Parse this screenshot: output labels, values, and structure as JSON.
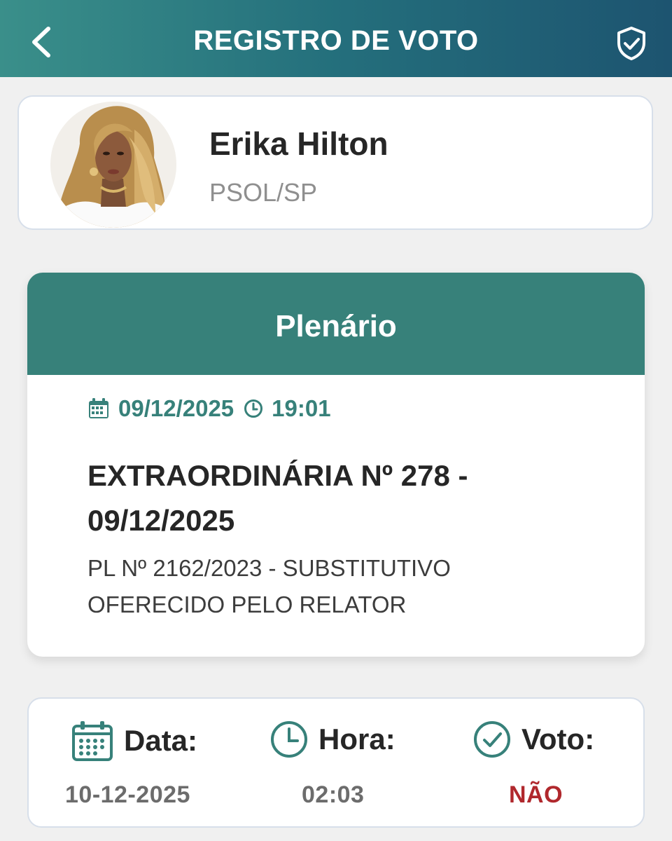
{
  "header": {
    "title": "REGISTRO DE VOTO",
    "back_icon": "chevron-left-icon",
    "shield_icon": "shield-check-icon",
    "background_colors": [
      "#3a8f8a",
      "#1d5470"
    ]
  },
  "profile": {
    "name": "Erika Hilton",
    "party": "PSOL/SP"
  },
  "session": {
    "title": "Plenário",
    "date": "09/12/2025",
    "time": "19:01",
    "name": "EXTRAORDINÁRIA Nº 278 - 09/12/2025",
    "description": "PL Nº 2162/2023 - SUBSTITUTIVO OFERECIDO PELO RELATOR",
    "accent_color": "#37817a"
  },
  "vote": {
    "date_label": "Data:",
    "date_value": "10-12-2025",
    "time_label": "Hora:",
    "time_value": "02:03",
    "vote_label": "Voto:",
    "vote_value": "NÃO",
    "vote_value_color": "#b0282d"
  }
}
